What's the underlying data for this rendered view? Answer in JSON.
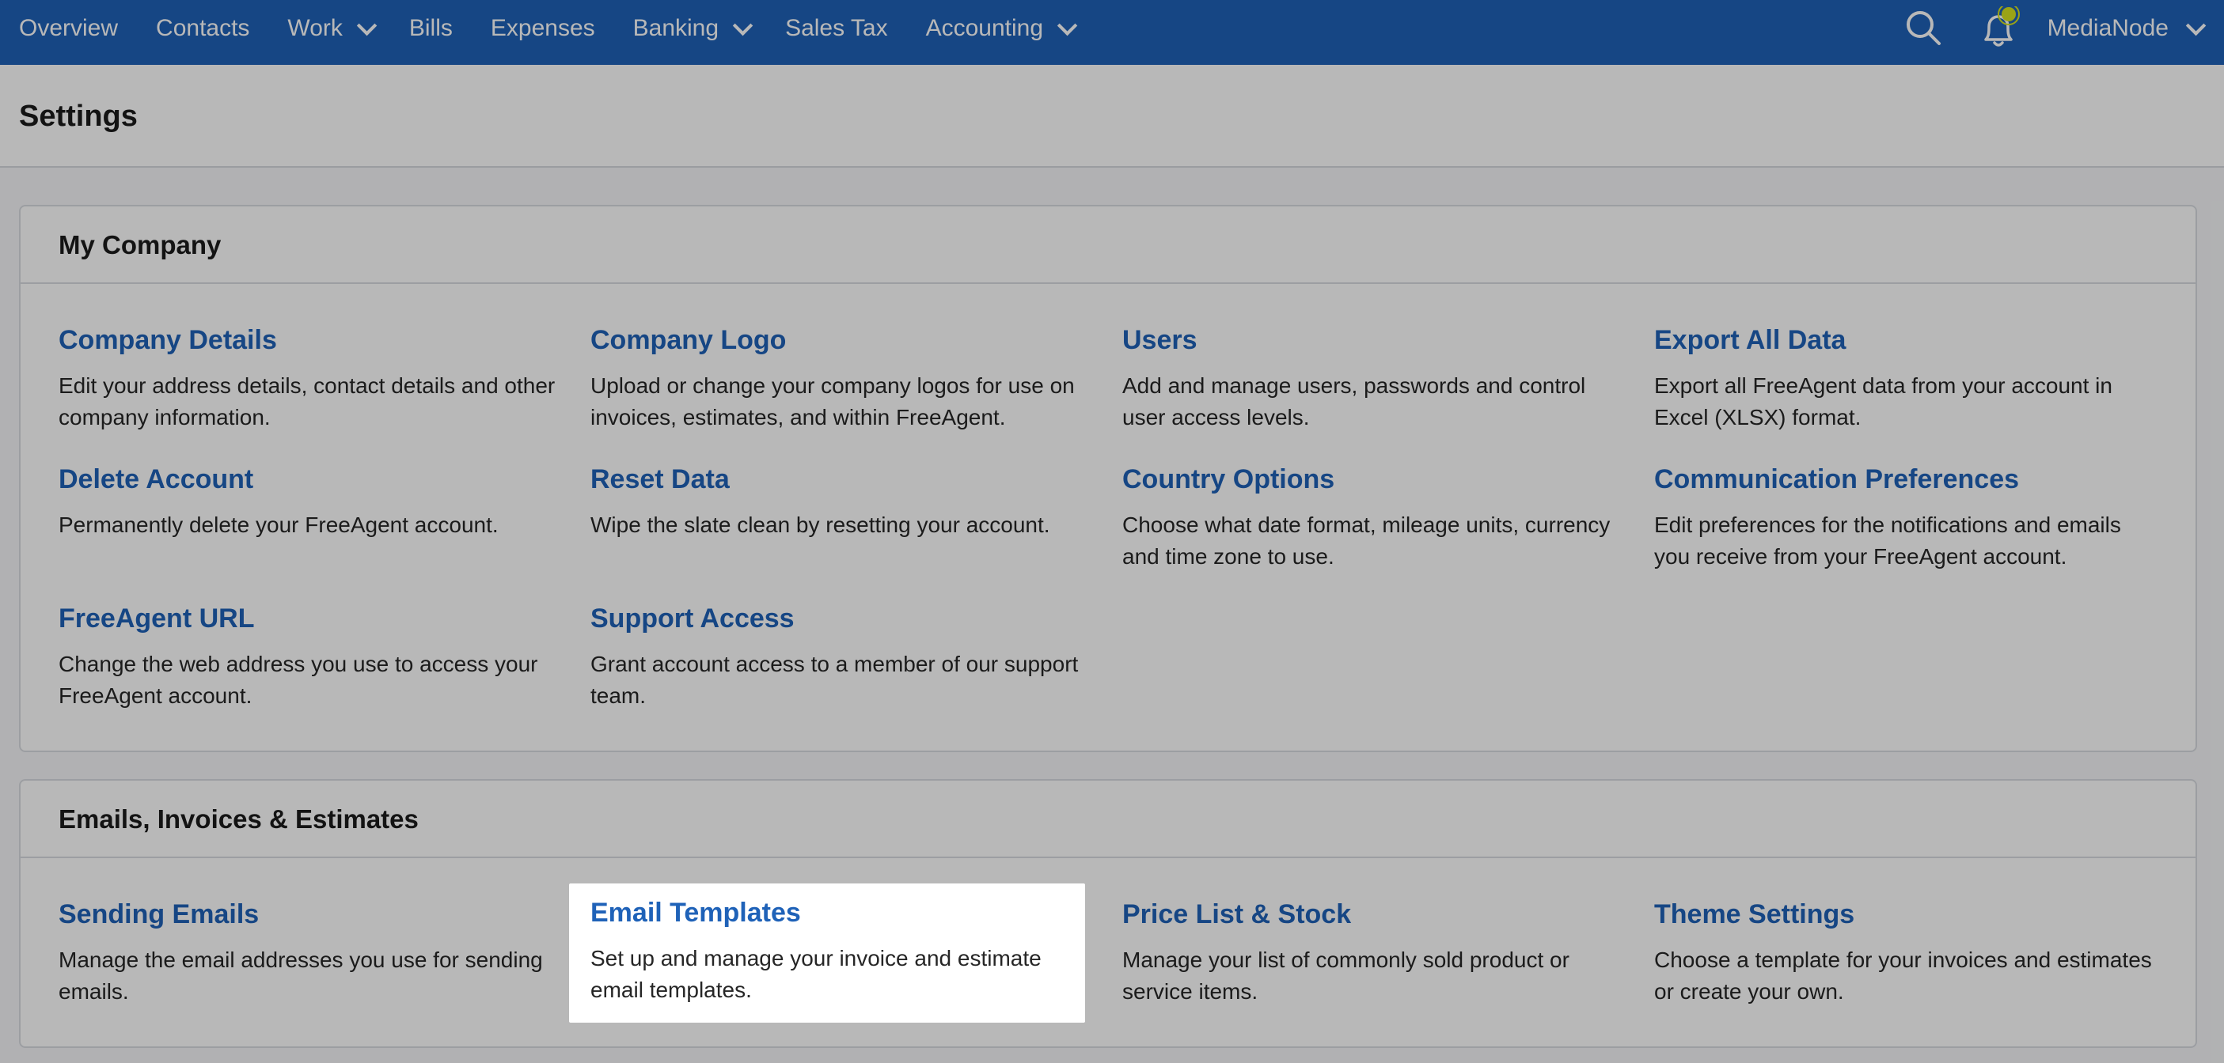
{
  "nav": {
    "items": [
      {
        "label": "Overview",
        "dropdown": false
      },
      {
        "label": "Contacts",
        "dropdown": false
      },
      {
        "label": "Work",
        "dropdown": true
      },
      {
        "label": "Bills",
        "dropdown": false
      },
      {
        "label": "Expenses",
        "dropdown": false
      },
      {
        "label": "Banking",
        "dropdown": true
      },
      {
        "label": "Sales Tax",
        "dropdown": false
      },
      {
        "label": "Accounting",
        "dropdown": true
      }
    ],
    "user_label": "MediaNode",
    "icons": [
      "search-icon",
      "notification-bell-icon",
      "chevron-down-icon"
    ]
  },
  "colors": {
    "nav_bg": "#1f62b8",
    "link": "#1f62b8",
    "notification_dot": "#d6e21f"
  },
  "page": {
    "title": "Settings"
  },
  "sections": [
    {
      "title": "My Company",
      "items": [
        {
          "title": "Company Details",
          "desc": "Edit your address details, contact details and other company information."
        },
        {
          "title": "Company Logo",
          "desc": "Upload or change your company logos for use on invoices, estimates, and within FreeAgent."
        },
        {
          "title": "Users",
          "desc": "Add and manage users, passwords and control user access levels."
        },
        {
          "title": "Export All Data",
          "desc": "Export all FreeAgent data from your account in Excel (XLSX) format."
        },
        {
          "title": "Delete Account",
          "desc": "Permanently delete your FreeAgent account."
        },
        {
          "title": "Reset Data",
          "desc": "Wipe the slate clean by resetting your account."
        },
        {
          "title": "Country Options",
          "desc": "Choose what date format, mileage units, currency and time zone to use."
        },
        {
          "title": "Communication Preferences",
          "desc": "Edit preferences for the notifications and emails you receive from your FreeAgent account."
        },
        {
          "title": "FreeAgent URL",
          "desc": "Change the web address you use to access your FreeAgent account."
        },
        {
          "title": "Support Access",
          "desc": "Grant account access to a member of our support team."
        }
      ]
    },
    {
      "title": "Emails, Invoices & Estimates",
      "items": [
        {
          "title": "Sending Emails",
          "desc": "Manage the email addresses you use for sending emails."
        },
        {
          "title": "Email Templates",
          "desc": "Set up and manage your invoice and estimate email templates."
        },
        {
          "title": "Price List & Stock",
          "desc": "Manage your list of commonly sold product or service items."
        },
        {
          "title": "Theme Settings",
          "desc": "Choose a template for your invoices and estimates or create your own."
        }
      ]
    }
  ]
}
